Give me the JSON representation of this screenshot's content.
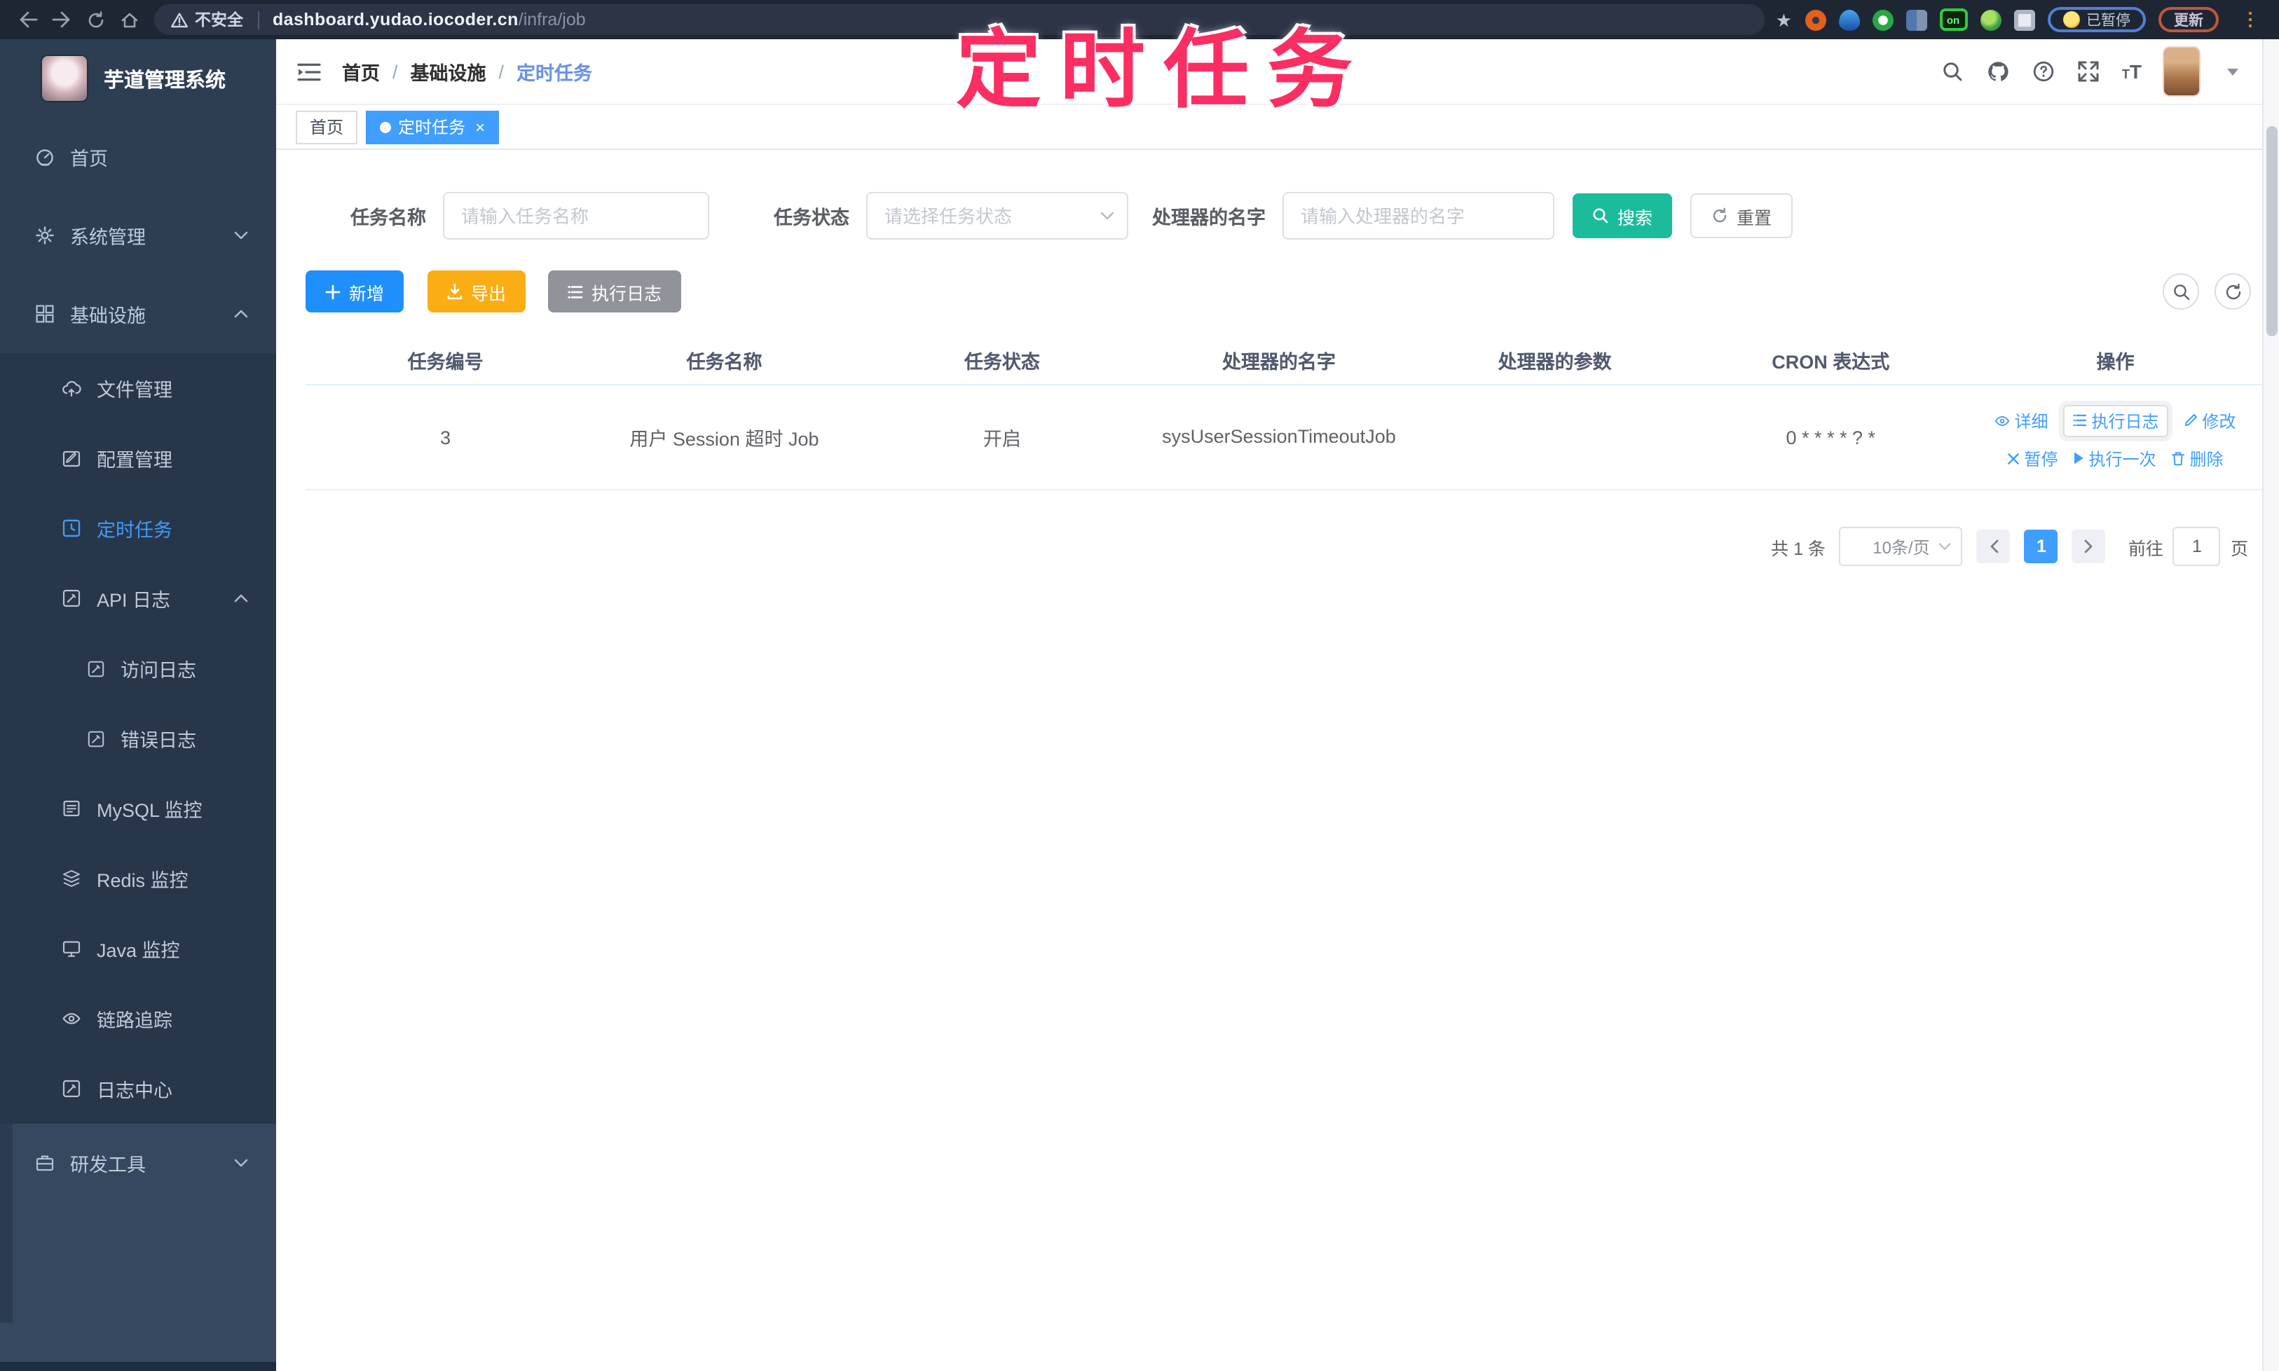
{
  "browser": {
    "security_label": "不安全",
    "url_domain": "dashboard.yudao.iocoder.cn",
    "url_path": "/infra/job",
    "extension_on_badge": "on",
    "paused_badge": "已暂停",
    "update_button": "更新"
  },
  "annotation": {
    "text": "定时任务",
    "color": "#fa2e62"
  },
  "sidebar": {
    "app_title": "芋道管理系统",
    "items": [
      {
        "label": "首页",
        "icon": "dashboard-icon"
      },
      {
        "label": "系统管理",
        "icon": "gear-icon",
        "arrow": "down"
      },
      {
        "label": "基础设施",
        "icon": "components-icon",
        "arrow": "up",
        "expanded": true
      },
      {
        "label": "文件管理",
        "icon": "cloud-upload-icon"
      },
      {
        "label": "配置管理",
        "icon": "edit-icon"
      },
      {
        "label": "定时任务",
        "icon": "clock-icon",
        "active": true
      },
      {
        "label": "API 日志",
        "icon": "log-icon",
        "arrow": "up",
        "expanded": true
      },
      {
        "label": "访问日志",
        "icon": "log-icon"
      },
      {
        "label": "错误日志",
        "icon": "log-icon"
      },
      {
        "label": "MySQL 监控",
        "icon": "database-icon"
      },
      {
        "label": "Redis 监控",
        "icon": "stack-icon"
      },
      {
        "label": "Java 监控",
        "icon": "monitor-icon"
      },
      {
        "label": "链路追踪",
        "icon": "eye-icon"
      },
      {
        "label": "日志中心",
        "icon": "log-icon"
      },
      {
        "label": "研发工具",
        "icon": "briefcase-icon",
        "arrow": "down"
      }
    ]
  },
  "navbar": {
    "breadcrumb": [
      "首页",
      "基础设施",
      "定时任务"
    ]
  },
  "tags": [
    {
      "label": "首页",
      "active": false
    },
    {
      "label": "定时任务",
      "active": true
    }
  ],
  "filters": {
    "job_name": {
      "label": "任务名称",
      "placeholder": "请输入任务名称"
    },
    "job_status": {
      "label": "任务状态",
      "placeholder": "请选择任务状态"
    },
    "handler_name": {
      "label": "处理器的名字",
      "placeholder": "请输入处理器的名字"
    },
    "search_label": "搜索",
    "reset_label": "重置"
  },
  "toolbar": {
    "add_label": "新增",
    "export_label": "导出",
    "exec_log_label": "执行日志"
  },
  "table": {
    "columns": [
      "任务编号",
      "任务名称",
      "任务状态",
      "处理器的名字",
      "处理器的参数",
      "CRON 表达式",
      "操作"
    ],
    "rows": [
      {
        "id": "3",
        "name": "用户 Session 超时 Job",
        "status": "开启",
        "handler": "sysUserSessionTimeoutJob",
        "param": "",
        "cron": "0 * * * * ? *"
      }
    ],
    "actions": [
      "详细",
      "执行日志",
      "修改",
      "暂停",
      "执行一次",
      "删除"
    ]
  },
  "pagination": {
    "total": "共 1 条",
    "page_size": "10条/页",
    "current_page": "1",
    "goto_label": "前往",
    "goto_value": "1",
    "unit_label": "页"
  },
  "colors": {
    "accent": "#409eff",
    "success": "#1abc9c",
    "warning": "#fbad15",
    "info": "#909399",
    "sidebar": "#2d3e53",
    "annotation": "#fa2e62"
  }
}
